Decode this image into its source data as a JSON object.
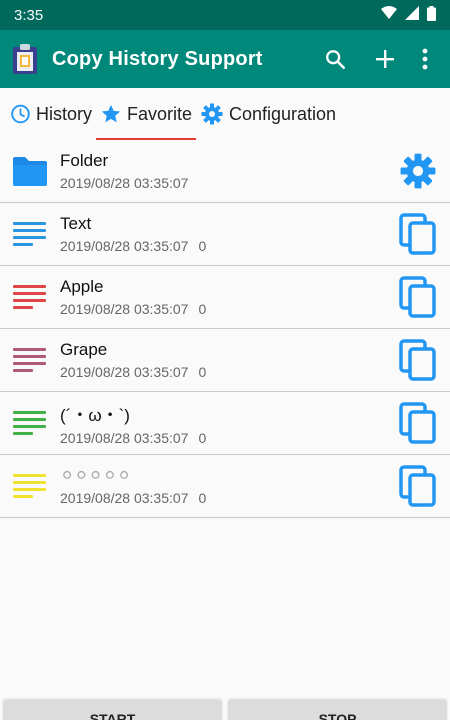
{
  "status": {
    "time": "3:35"
  },
  "app": {
    "title": "Copy History Support"
  },
  "tabs": [
    {
      "label": "History",
      "icon": "clock-icon"
    },
    {
      "label": "Favorite",
      "icon": "star-icon",
      "active": true
    },
    {
      "label": "Configuration",
      "icon": "gear-icon"
    }
  ],
  "items": [
    {
      "title": "Folder",
      "date": "2019/08/28 03:35:07",
      "count": "",
      "icon": "folder-icon",
      "color": "#2196f3",
      "action": "settings-icon"
    },
    {
      "title": "Text",
      "date": "2019/08/28 03:35:07",
      "count": "0",
      "icon": "lines-icon",
      "color": "#2b96e0",
      "action": "copy-icon"
    },
    {
      "title": "Apple",
      "date": "2019/08/28 03:35:07",
      "count": "0",
      "icon": "lines-icon",
      "color": "#e0454a",
      "action": "copy-icon"
    },
    {
      "title": "Grape",
      "date": "2019/08/28 03:35:07",
      "count": "0",
      "icon": "lines-icon",
      "color": "#b05a7a",
      "action": "copy-icon"
    },
    {
      "title": "(´・ω・`)",
      "date": "2019/08/28 03:35:07",
      "count": "0",
      "icon": "lines-icon",
      "color": "#43b048",
      "action": "copy-icon"
    },
    {
      "title": "⚪⚪⚪⚪⚪",
      "date": "2019/08/28 03:35:07",
      "count": "0",
      "icon": "lines-icon",
      "color": "#f2e230",
      "action": "copy-icon"
    }
  ],
  "buttons": {
    "start": "START",
    "stop": "STOP"
  },
  "colors": {
    "statusBar": "#00695c",
    "appBar": "#00897b",
    "accent": "#2196f3",
    "tabIndicator": "#e53935"
  }
}
